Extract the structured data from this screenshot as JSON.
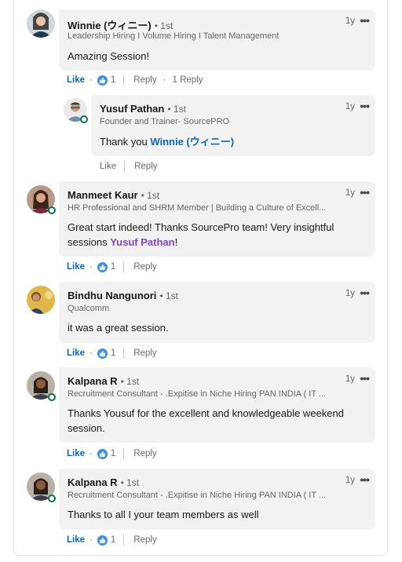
{
  "comments": [
    {
      "name": "Winnie (ウィニー)",
      "degree": "• 1st",
      "headline": "Leadership Hiring I Volume Hiring I Talent Management",
      "time": "1y",
      "text": "Amazing Session!",
      "like": "Like",
      "reaction_count": "1",
      "reply": "Reply",
      "reply_count": "1 Reply"
    },
    {
      "name": "Yusuf Pathan",
      "degree": "• 1st",
      "headline": "Founder and Trainer- SourcePRO",
      "time": "1y",
      "text_prefix": "Thank you ",
      "mention": "Winnie (ウィニー)",
      "like": "Like",
      "reply": "Reply"
    },
    {
      "name": "Manmeet Kaur",
      "degree": "• 1st",
      "headline": "HR Professional and SHRM Member | Building a Culture of Excell...",
      "time": "1y",
      "text_line1": "Great start indeed! Thanks SourcePro team! Very insightful",
      "text_line2_prefix": "sessions ",
      "mention": "Yusuf Pathan",
      "text_line2_suffix": "!",
      "like": "Like",
      "reaction_count": "1",
      "reply": "Reply"
    },
    {
      "name": "Bindhu Nangunori",
      "degree": "• 1st",
      "headline": "Qualcomm",
      "time": "1y",
      "text": "it was a great session.",
      "like": "Like",
      "reaction_count": "1",
      "reply": "Reply"
    },
    {
      "name": "Kalpana R",
      "degree": "• 1st",
      "headline": "Recruitment Consultant - .Expitise in Niche Hiring PAN INDIA ( IT ...",
      "time": "1y",
      "text_line1": "Thanks Yousuf for the excellent and knowledgeable weekend",
      "text_line2": "session.",
      "like": "Like",
      "reaction_count": "1",
      "reply": "Reply"
    },
    {
      "name": "Kalpana R",
      "degree": "• 1st",
      "headline": "Recruitment Consultant - .Expitise in Niche Hiring PAN INDIA ( IT ...",
      "time": "1y",
      "text": "Thanks to all I your team members as well",
      "like": "Like",
      "reaction_count": "1",
      "reply": "Reply"
    }
  ],
  "icons": {
    "more": "more-horizontal-icon",
    "reaction": "like-reaction-icon"
  },
  "colors": {
    "link": "#0a66c2",
    "mention_purple": "#8344cc",
    "presence": "#057642",
    "bubble": "#f2f2f2"
  }
}
